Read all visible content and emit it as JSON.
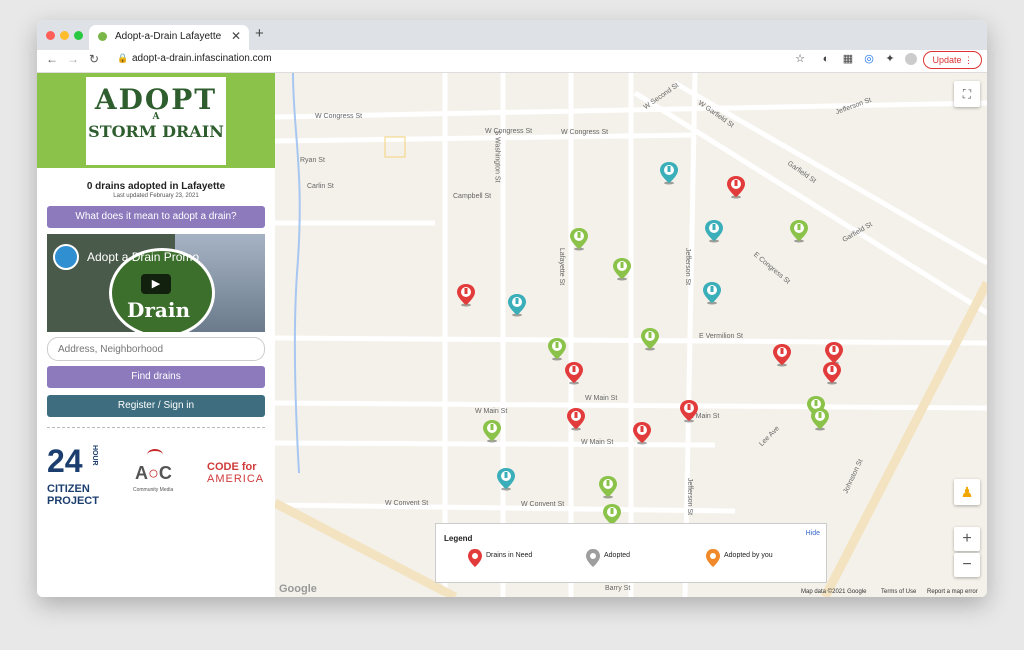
{
  "browser": {
    "tab_title": "Adopt-a-Drain Lafayette",
    "url": "adopt-a-drain.infascination.com",
    "update_label": "Update"
  },
  "sidebar": {
    "logo_line1": "ADOPT",
    "logo_line2": "STORM DRAIN",
    "logo_small": "A",
    "adopted_count": "0 drains adopted in Lafayette",
    "last_updated": "Last updated February 23, 2021",
    "what_button": "What does it mean to adopt a drain?",
    "video_title": "Adopt a Drain Promo",
    "video_overlay": "Drain",
    "search_placeholder": "Address, Neighborhood",
    "find_button": "Find drains",
    "register_button": "Register / Sign in",
    "sponsors": {
      "citizen_24": "24",
      "citizen_hour": "HOUR",
      "citizen_line1": "CITIZEN",
      "citizen_line2": "PROJECT",
      "aoc_label": "Community Media",
      "code_line1": "CODE for",
      "code_line2": "AMERICA"
    }
  },
  "map": {
    "streets": [
      "W Congress St",
      "W Congress St",
      "W Second St",
      "W Garfield St",
      "Jefferson St",
      "Garfield St",
      "Campbell St",
      "Ryan St",
      "Carlin St",
      "Lafayette St",
      "S Washington St",
      "E Vermilion St",
      "W Main St",
      "W Main St",
      "W Main St",
      "W Convent St",
      "W Convent St",
      "Johnston St",
      "Jefferson St",
      "Lee Ave",
      "E Main St",
      "Barry St",
      "Jefferson St",
      "E Congress St",
      "Garfield St"
    ],
    "legend": {
      "title": "Legend",
      "hide": "Hide",
      "need": "Drains in Need",
      "adopted": "Adopted",
      "by_you": "Adopted by you"
    },
    "footer": {
      "data": "Map data ©2021 Google",
      "terms": "Terms of Use",
      "report": "Report a map error"
    },
    "google_logo": "Google",
    "colors": {
      "need": "#e23b3b",
      "adopted_green": "#8bc34a",
      "teal": "#3aafb9",
      "adopted_gray": "#9e9e9e",
      "by_you": "#f0892a"
    }
  }
}
